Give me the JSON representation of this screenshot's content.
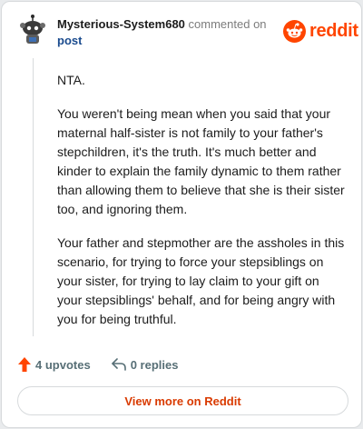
{
  "comment": {
    "username": "Mysterious-System680",
    "commented_on": "commented on",
    "post_link": "post",
    "paragraphs": [
      "NTA.",
      "You weren't being mean when you said that your maternal half-sister is not family to your father's stepchildren, it's the truth. It's much better and kinder to explain the family dynamic to them rather than allowing them to believe that she is their sister too, and ignoring them.",
      "Your father and stepmother are the assholes in this scenario, for trying to force your stepsiblings on your sister, for trying to lay claim to your gift on your stepsiblings' behalf, and for being angry with you for being truthful."
    ]
  },
  "brand": {
    "name": "reddit",
    "color": "#ff4500"
  },
  "actions": {
    "upvotes": "4 upvotes",
    "replies": "0 replies",
    "upvote_icon": "upvote-arrow-icon",
    "reply_icon": "reply-arrow-icon"
  },
  "view_more": {
    "label": "View more on Reddit"
  },
  "colors": {
    "accent": "#ff4500",
    "link": "#1a4b8e",
    "button_text": "#d93a00"
  }
}
